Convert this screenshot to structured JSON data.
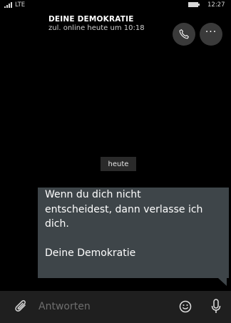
{
  "status_bar": {
    "network": "LTE",
    "time": "12:27",
    "signal_icon": "signal-bars-icon",
    "battery_icon": "battery-icon"
  },
  "header": {
    "contact_name": "DEINE DEMOKRATIE",
    "last_seen": "zul. online heute um 10:18",
    "call_icon": "phone-icon",
    "more_label": "···"
  },
  "chat": {
    "date_separator": "heute",
    "message": {
      "lines": [
        "Wenn du dich nicht",
        "entscheidest, dann verlasse ich",
        "dich."
      ],
      "signature": "Deine Demokratie"
    }
  },
  "composer": {
    "placeholder": "Antworten",
    "value": "",
    "attach_icon": "paperclip-icon",
    "emoji_icon": "smiley-icon",
    "mic_icon": "microphone-icon"
  },
  "colors": {
    "background": "#000000",
    "bubble": "#3e4549",
    "button_circle": "#3a3a3a",
    "composer_bar": "#1f1f1f",
    "placeholder": "#6e6e6e"
  }
}
